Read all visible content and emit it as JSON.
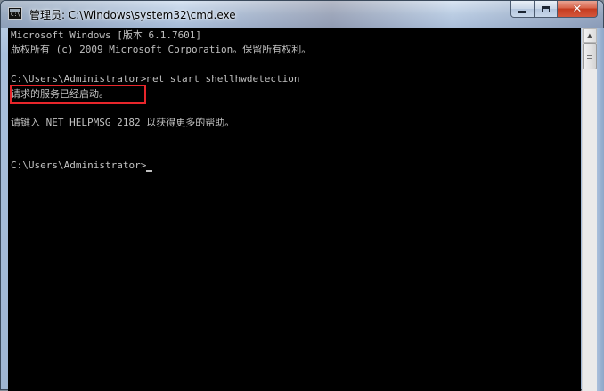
{
  "window": {
    "title": "管理员: C:\\Windows\\system32\\cmd.exe",
    "icon": "cmd-icon",
    "icon_text": "C:\\",
    "controls": {
      "minimize": "minimize-icon",
      "maximize": "maximize-icon",
      "close": "close-icon"
    }
  },
  "console": {
    "lines": [
      "Microsoft Windows [版本 6.1.7601]",
      "版权所有 (c) 2009 Microsoft Corporation。保留所有权利。",
      "",
      "C:\\Users\\Administrator>net start shellhwdetection",
      "请求的服务已经启动。",
      "",
      "请键入 NET HELPMSG 2182 以获得更多的帮助。",
      "",
      "",
      "C:\\Users\\Administrator>"
    ],
    "highlighted_line": "请求的服务已经启动。",
    "colors": {
      "background": "#000000",
      "text": "#c0c0c0",
      "highlight_border": "#e8262b"
    }
  }
}
